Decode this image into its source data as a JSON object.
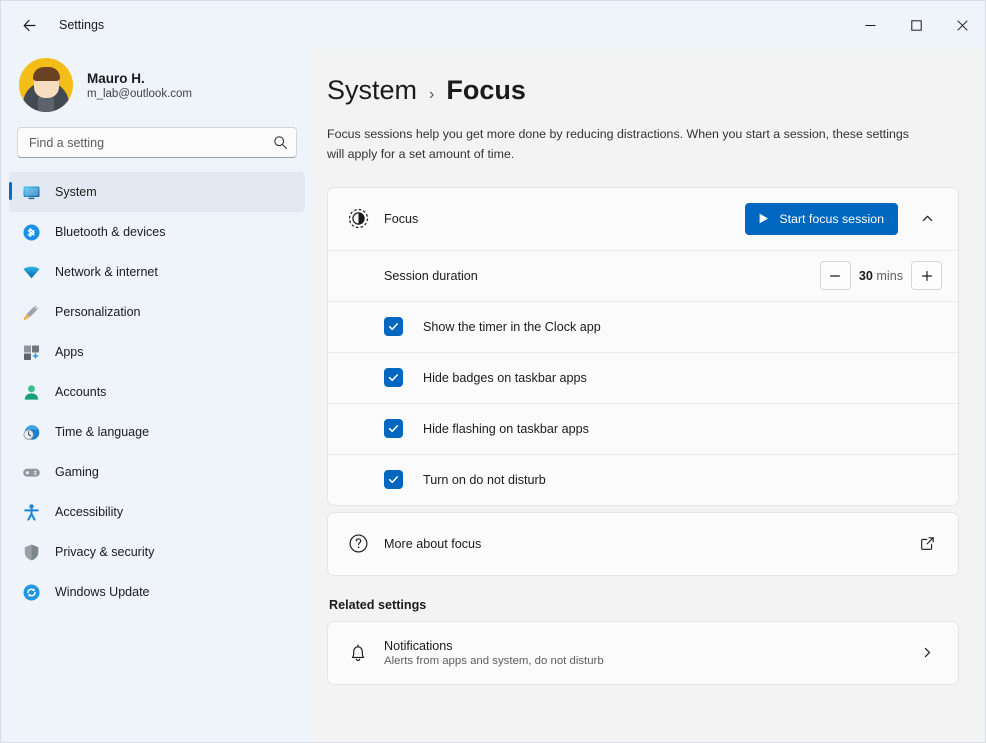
{
  "titlebar": {
    "back_icon": "back-arrow-icon",
    "title": "Settings",
    "minimize": "minimize-icon",
    "maximize": "maximize-icon",
    "close": "close-icon"
  },
  "account": {
    "name": "Mauro H.",
    "email": "m_lab@outlook.com"
  },
  "search": {
    "placeholder": "Find a setting",
    "icon": "search-icon"
  },
  "sidebar": {
    "items": [
      {
        "label": "System",
        "icon": "monitor-icon",
        "active": true
      },
      {
        "label": "Bluetooth & devices",
        "icon": "bluetooth-icon",
        "active": false
      },
      {
        "label": "Network & internet",
        "icon": "wifi-icon",
        "active": false
      },
      {
        "label": "Personalization",
        "icon": "paintbrush-icon",
        "active": false
      },
      {
        "label": "Apps",
        "icon": "apps-icon",
        "active": false
      },
      {
        "label": "Accounts",
        "icon": "person-icon",
        "active": false
      },
      {
        "label": "Time & language",
        "icon": "clock-globe-icon",
        "active": false
      },
      {
        "label": "Gaming",
        "icon": "gamepad-icon",
        "active": false
      },
      {
        "label": "Accessibility",
        "icon": "accessibility-icon",
        "active": false
      },
      {
        "label": "Privacy & security",
        "icon": "shield-icon",
        "active": false
      },
      {
        "label": "Windows Update",
        "icon": "update-sync-icon",
        "active": false
      }
    ]
  },
  "page": {
    "breadcrumb_root": "System",
    "breadcrumb_separator": "›",
    "breadcrumb_leaf": "Focus",
    "description": "Focus sessions help you get more done by reducing distractions. When you start a session, these settings will apply for a set amount of time."
  },
  "focus_card": {
    "icon": "focus-timer-icon",
    "label": "Focus",
    "start_button": "Start focus session",
    "start_button_icon": "play-icon",
    "collapse_icon": "chevron-up-icon",
    "duration": {
      "label": "Session duration",
      "decrease_icon": "minus-icon",
      "increase_icon": "plus-icon",
      "value": "30",
      "unit": "mins"
    },
    "options": [
      {
        "label": "Show the timer in the Clock app",
        "checked": true
      },
      {
        "label": "Hide badges on taskbar apps",
        "checked": true
      },
      {
        "label": "Hide flashing on taskbar apps",
        "checked": true
      },
      {
        "label": "Turn on do not disturb",
        "checked": true
      }
    ]
  },
  "more_about": {
    "icon": "question-circle-icon",
    "label": "More about focus",
    "open_icon": "external-link-icon"
  },
  "related": {
    "heading": "Related settings",
    "items": [
      {
        "icon": "bell-icon",
        "title": "Notifications",
        "subtitle": "Alerts from apps and system, do not disturb",
        "chevron": "chevron-right-icon"
      }
    ]
  },
  "colors": {
    "accent": "#0067c0",
    "selection_pill": "#0f6cbd",
    "sidebar_bg": "#eff3fa",
    "card_bg": "#fbfbfb",
    "content_bg": "#f3f3f3",
    "avatar_bg": "#f5bd17"
  }
}
